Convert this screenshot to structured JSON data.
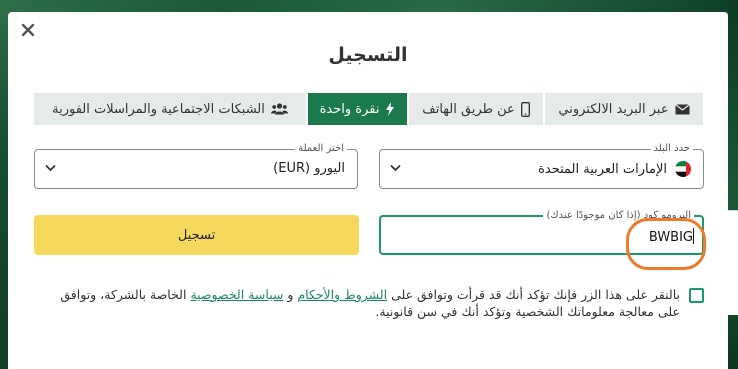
{
  "modal": {
    "title": "التسجيل",
    "close_icon": "close-icon"
  },
  "tabs": [
    {
      "label": "عبر البريد الالكتروني",
      "icon": "envelope-icon",
      "active": false
    },
    {
      "label": "عن طريق الهاتف",
      "icon": "mobile-phone-icon",
      "active": false
    },
    {
      "label": "نقرة واحدة",
      "icon": "lightning-bolt-icon",
      "active": true
    },
    {
      "label": "الشبكات الاجتماعية والمراسلات الفورية",
      "icon": "users-icon",
      "active": false
    }
  ],
  "country": {
    "label": "حدد البلد",
    "value": "الإمارات العربية المتحدة",
    "flag": "uae-flag-icon"
  },
  "currency": {
    "label": "اختر العملة",
    "value": "اليورو (EUR)"
  },
  "promo": {
    "label": "البرومو كود (إذا كان موجودًا عندك)",
    "value": "BWBIG"
  },
  "register_button": {
    "label": "تسجيل"
  },
  "consent": {
    "prefix": "بالنقر على هذا الزر فإنك تؤكد أنك قد قرأت وتوافق على ",
    "terms_link": "الشروط والأحكام",
    "and": " و ",
    "privacy_link": "سياسة الخصوصية",
    "suffix": " الخاصة بالشركة، وتوافق على معالجة معلوماتك الشخصية وتؤكد أنك في سن قانونية."
  },
  "colors": {
    "accent_green": "#1b7a4c",
    "button_yellow": "#f6d95c",
    "highlight_orange": "#f07a2a"
  }
}
